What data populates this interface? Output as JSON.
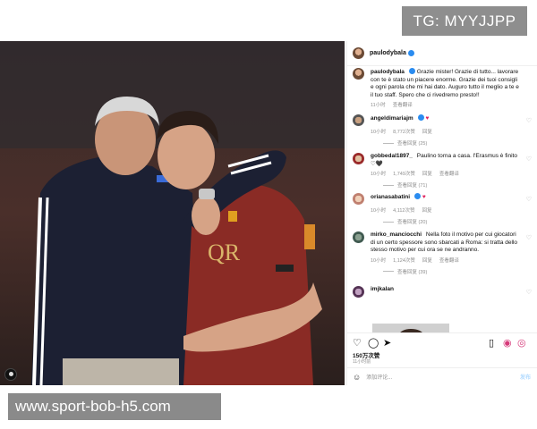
{
  "watermark_tg": "TG: MYYJJPP",
  "watermark_site": "www.sport-bob-h5.com",
  "post": {
    "username": "paulodybala",
    "caption": "Grazie mister! Grazie di tutto... lavorare con te è stato un piacere enorme. Grazie dei tuoi consigli e ogni parola che mi hai dato. Auguro tutto il meglio a te e il tuo staff. Spero che ci rivedremo presto!!",
    "caption_meta": {
      "time": "11小时",
      "translate": "查看翻译"
    }
  },
  "comments": [
    {
      "user": "angeldimariajm",
      "text": "",
      "emoji": "♥",
      "time": "10小时",
      "likes": "8,772次赞",
      "reply": "回复",
      "replies": "查看回复 (25)"
    },
    {
      "user": "gobbedal1897_",
      "text": "Paulino torna a casa. l'Erasmus è finito ♡🖤",
      "time": "10小时",
      "likes": "1,749次赞",
      "reply": "回复",
      "translate": "查看翻译",
      "replies": "查看回复 (71)"
    },
    {
      "user": "orianasabatini",
      "text": "",
      "emoji": "♥",
      "time": "10小时",
      "likes": "4,112次赞",
      "reply": "回复",
      "replies": "查看回复 (20)"
    },
    {
      "user": "mirko_manciocchi",
      "text": "Nella foto il motivo per cui giocatori di un certo spessore sono sbarcati a Roma: si tratta dello stesso motivo per cui ora se ne andranno.",
      "time": "10小时",
      "likes": "1,124次赞",
      "reply": "回复",
      "translate": "查看翻译",
      "replies": "查看回复 (39)"
    },
    {
      "user": "imjkalan",
      "text": ""
    }
  ],
  "footer": {
    "likes": "150万次赞",
    "time": "11小时前",
    "add_comment_placeholder": "添加评论...",
    "post_button": "发布"
  },
  "colors": {
    "verified": "#2a8cf0",
    "heart": "#e0245e",
    "muted": "#8e8e8e"
  },
  "icons": [
    "heart-icon",
    "comment-icon",
    "share-icon",
    "bookmark-icon",
    "emoji-icon",
    "user-tag-icon",
    "more-icon"
  ]
}
